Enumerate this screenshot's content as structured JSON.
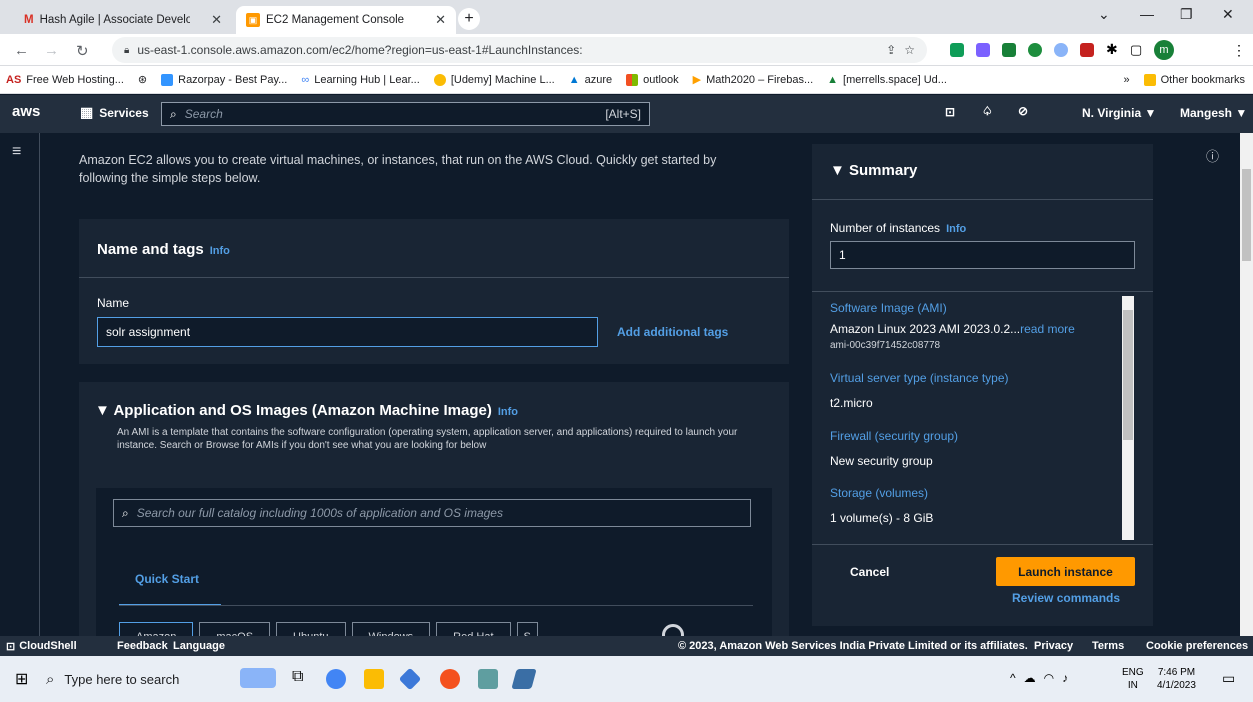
{
  "browser": {
    "tabs": [
      {
        "title": "Hash Agile | Associate Developm"
      },
      {
        "title": "EC2 Management Console"
      }
    ],
    "url": "us-east-1.console.aws.amazon.com/ec2/home?region=us-east-1#LaunchInstances:",
    "bookmarks": [
      "Free Web Hosting...",
      "Razorpay - Best Pay...",
      "Learning Hub | Lear...",
      "[Udemy] Machine L...",
      "azure",
      "outlook",
      "Math2020 – Firebas...",
      "[merrells.space] Ud..."
    ],
    "other_bookmarks": "Other bookmarks",
    "profile_initial": "m",
    "more_bookmarks": "»"
  },
  "aws_nav": {
    "logo": "aws",
    "services": "Services",
    "search_placeholder": "Search",
    "search_hint": "[Alt+S]",
    "region": "N. Virginia ▼",
    "user": "Mangesh ▼"
  },
  "intro": "Amazon EC2 allows you to create virtual machines, or instances, that run on the AWS Cloud. Quickly get started by following the simple steps below.",
  "name_tags": {
    "title": "Name and tags",
    "info": "Info",
    "name_label": "Name",
    "name_value": "solr assignment",
    "add_tags": "Add additional tags"
  },
  "ami": {
    "title": "▼ Application and OS Images (Amazon Machine Image)",
    "info": "Info",
    "desc": "An AMI is a template that contains the software configuration (operating system, application server, and applications) required to launch your instance. Search or Browse for AMIs if you don't see what you are looking for below",
    "search_placeholder": "Search our full catalog including 1000s of application and OS images",
    "quick_start": "Quick Start",
    "os_tabs": [
      "Amazon",
      "macOS",
      "Ubuntu",
      "Windows",
      "Red Hat",
      "S"
    ]
  },
  "summary": {
    "title": "▼ Summary",
    "num_instances_label": "Number of instances",
    "info": "Info",
    "num_instances": "1",
    "ami_label": "Software Image (AMI)",
    "ami_value": "Amazon Linux 2023 AMI 2023.0.2...",
    "read_more": "read more",
    "ami_id": "ami-00c39f71452c08778",
    "type_label": "Virtual server type (instance type)",
    "type_value": "t2.micro",
    "firewall_label": "Firewall (security group)",
    "firewall_value": "New security group",
    "storage_label": "Storage (volumes)",
    "storage_value": "1 volume(s) - 8 GiB",
    "cancel": "Cancel",
    "launch": "Launch instance",
    "review": "Review commands"
  },
  "footer": {
    "cloudshell": "CloudShell",
    "feedback": "Feedback",
    "language": "Language",
    "copyright": "© 2023, Amazon Web Services India Private Limited or its affiliates.",
    "privacy": "Privacy",
    "terms": "Terms",
    "cookie": "Cookie preferences"
  },
  "taskbar": {
    "search_placeholder": "Type here to search",
    "lang1": "ENG",
    "lang2": "IN",
    "time": "7:46 PM",
    "date": "4/1/2023"
  },
  "colors": {
    "aws_nav": "#232f3e",
    "accent_orange": "#ff9900",
    "link_blue": "#539fe5",
    "panel": "#192534"
  }
}
